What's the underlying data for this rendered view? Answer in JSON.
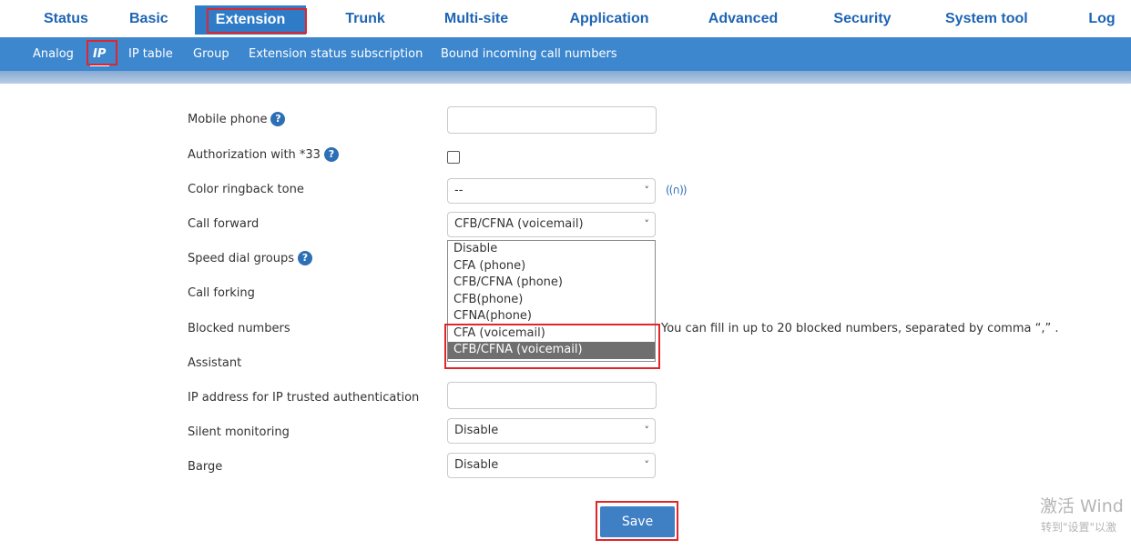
{
  "top_nav": {
    "tabs": [
      "Status",
      "Basic",
      "Extension",
      "Trunk",
      "Multi-site",
      "Application",
      "Advanced",
      "Security",
      "System tool",
      "Log"
    ],
    "active": "Extension"
  },
  "sub_nav": {
    "items": [
      "Analog",
      "IP",
      "IP table",
      "Group",
      "Extension status subscription",
      "Bound incoming call numbers"
    ],
    "active": "IP"
  },
  "form": {
    "mobile_phone": {
      "label": "Mobile phone",
      "value": ""
    },
    "authorization_33": {
      "label": "Authorization with *33",
      "checked": false
    },
    "color_ringback_tone": {
      "label": "Color ringback tone",
      "value": "--"
    },
    "call_forward": {
      "label": "Call forward",
      "value": "CFB/CFNA (voicemail)"
    },
    "speed_dial_groups": {
      "label": "Speed dial groups"
    },
    "call_forking": {
      "label": "Call forking"
    },
    "blocked_numbers": {
      "label": "Blocked numbers",
      "note": "You can fill in up to 20 blocked numbers, separated by comma “,” ."
    },
    "assistant": {
      "label": "Assistant"
    },
    "ip_trusted_auth": {
      "label": "IP address for IP trusted authentication",
      "value": ""
    },
    "silent_monitoring": {
      "label": "Silent monitoring",
      "value": "Disable"
    },
    "barge": {
      "label": "Barge",
      "value": "Disable"
    }
  },
  "call_forward_dropdown": {
    "options": [
      "Disable",
      "CFA (phone)",
      "CFB/CFNA (phone)",
      "CFB(phone)",
      "CFNA(phone)",
      "CFA (voicemail)",
      "CFB/CFNA (voicemail)"
    ],
    "selected": "CFB/CFNA (voicemail)"
  },
  "save_label": "Save",
  "watermark": {
    "line1": "激活 Wind",
    "line2": "转到\"设置\"以激"
  },
  "colors": {
    "accent": "#3d87cf",
    "nav_text": "#1e64b4",
    "highlight_box": "#e0252b",
    "selected_option": "#6f6f6f"
  }
}
